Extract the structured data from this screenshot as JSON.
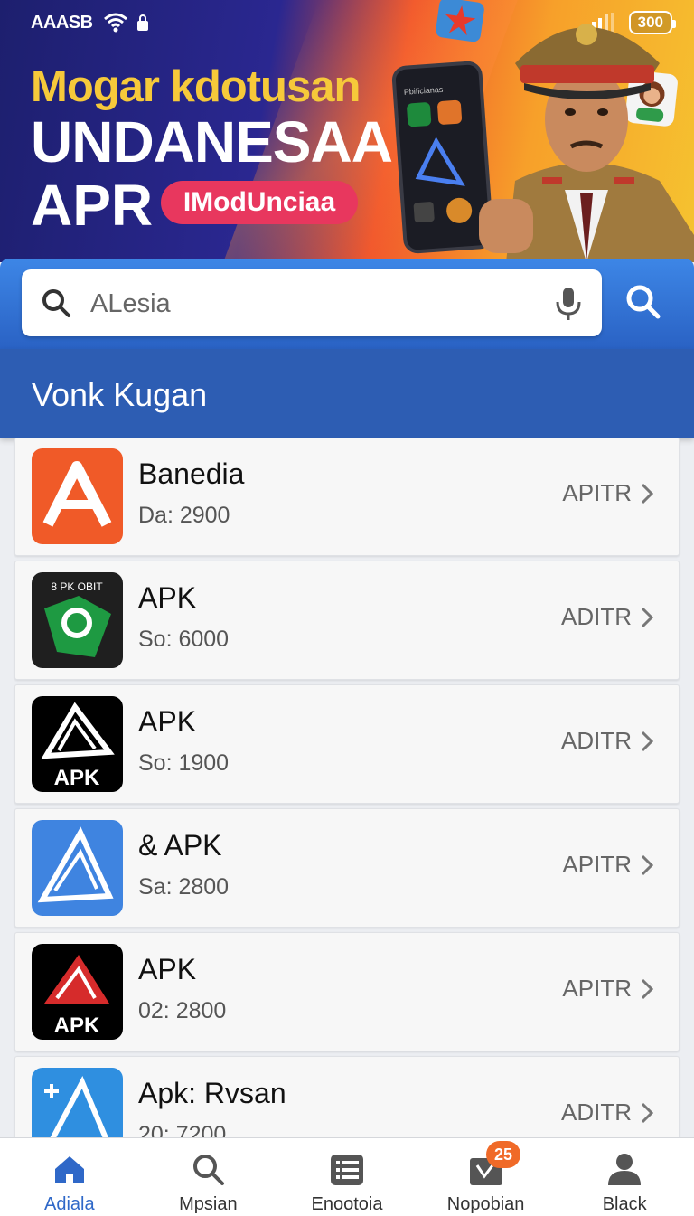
{
  "status_bar": {
    "carrier": "AAASB",
    "battery": "300"
  },
  "hero": {
    "line1": "Mogar kdotusan",
    "line2": "UNDANESAA",
    "line3": "APR",
    "badge": "IModUnciaa",
    "phone_title": "Pbificianas"
  },
  "search": {
    "value": "ALesia"
  },
  "section": {
    "title": "Vonk Kugan"
  },
  "apps": [
    {
      "name": "Banedia",
      "meta": "Da: 2900",
      "action": "APITR",
      "icon": "orange-a-icon",
      "bg": "#f05a28"
    },
    {
      "name": "APK",
      "meta": "So: 6000",
      "action": "ADITR",
      "icon": "green-apk-icon",
      "bg": "#1f1f1f",
      "icon_text": "8 PK OBIT"
    },
    {
      "name": "APK",
      "meta": "So: 1900",
      "action": "ADITR",
      "icon": "black-apk-icon",
      "bg": "#000000",
      "icon_text": "APK"
    },
    {
      "name": "& APK",
      "meta": "Sa: 2800",
      "action": "APITR",
      "icon": "blue-a-icon",
      "bg": "#3f84e0"
    },
    {
      "name": "APK",
      "meta": "02: 2800",
      "action": "APITR",
      "icon": "red-apk-icon",
      "bg": "#000000",
      "icon_text": "APK"
    },
    {
      "name": "Apk: Rvsan",
      "meta": "20: 7200",
      "action": "ADITR",
      "icon": "lightblue-a-icon",
      "bg": "#2f8fe0"
    }
  ],
  "nav": [
    {
      "label": "Adiala",
      "icon": "home-icon",
      "active": true
    },
    {
      "label": "Mpsian",
      "icon": "search-icon"
    },
    {
      "label": "Enootoia",
      "icon": "list-icon"
    },
    {
      "label": "Nopobian",
      "icon": "inbox-icon",
      "badge": "25"
    },
    {
      "label": "Black",
      "icon": "profile-icon"
    }
  ],
  "colors": {
    "accent": "#2f68c8",
    "header": "#2d5db3",
    "badge": "#e8375e",
    "notify": "#f06a28"
  }
}
